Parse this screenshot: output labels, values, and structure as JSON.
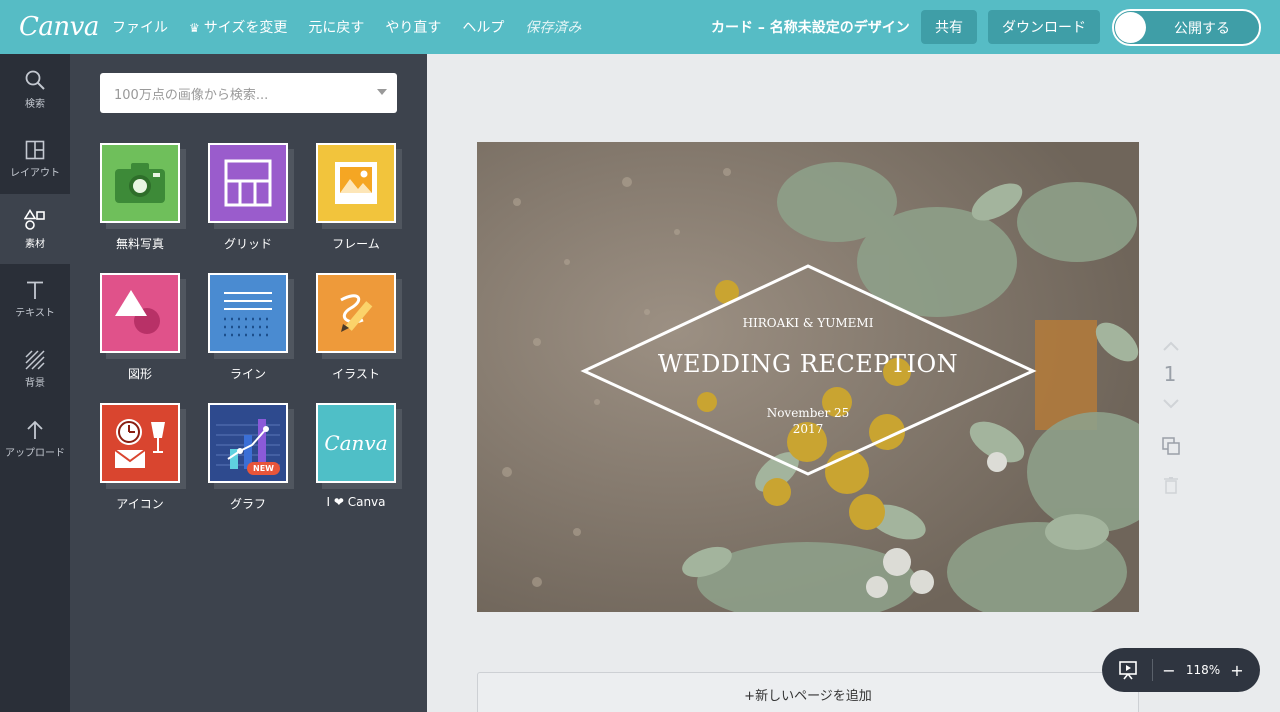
{
  "app": {
    "logo": "Canva"
  },
  "menu": {
    "file": "ファイル",
    "resize": "サイズを変更",
    "undo": "元に戻す",
    "redo": "やり直す",
    "help": "ヘルプ",
    "saved": "保存済み"
  },
  "header": {
    "doc_title": "カード – 名称未設定のデザイン",
    "share": "共有",
    "download": "ダウンロード",
    "publish": "公開する"
  },
  "leftnav": {
    "items": [
      {
        "label": "検索",
        "icon": "search-icon"
      },
      {
        "label": "レイアウト",
        "icon": "layout-icon"
      },
      {
        "label": "素材",
        "icon": "elements-icon",
        "active": true
      },
      {
        "label": "テキスト",
        "icon": "text-icon"
      },
      {
        "label": "背景",
        "icon": "background-icon"
      },
      {
        "label": "アップロード",
        "icon": "upload-icon"
      }
    ]
  },
  "panel": {
    "search_placeholder": "100万点の画像から検索...",
    "tiles": [
      {
        "label": "無料写真",
        "color": "#6fbf5b",
        "icon": "camera-icon"
      },
      {
        "label": "グリッド",
        "color": "#9a5ccc",
        "icon": "grid-icon"
      },
      {
        "label": "フレーム",
        "color": "#f2c43c",
        "icon": "frame-icon"
      },
      {
        "label": "図形",
        "color": "#e0528a",
        "icon": "shapes-icon"
      },
      {
        "label": "ライン",
        "color": "#4a8bd1",
        "icon": "lines-icon"
      },
      {
        "label": "イラスト",
        "color": "#ee9a3a",
        "icon": "illustration-icon"
      },
      {
        "label": "アイコン",
        "color": "#d9452f",
        "icon": "icons-icon"
      },
      {
        "label": "グラフ",
        "color": "#2e4a8e",
        "icon": "chart-icon",
        "badge": "NEW"
      },
      {
        "label": "I ❤ Canva",
        "color": "#4fbfc7",
        "icon": "canva-logo-icon",
        "logo_text": "Canva"
      }
    ]
  },
  "design": {
    "names": "HIROAKI & YUMEMI",
    "title": "WEDDING RECEPTION",
    "date_line1": "November 25",
    "date_line2": "2017"
  },
  "page": {
    "number": "1",
    "add_page": "+新しいページを追加"
  },
  "zoom": {
    "value": "118%",
    "minus": "−",
    "plus": "+"
  }
}
